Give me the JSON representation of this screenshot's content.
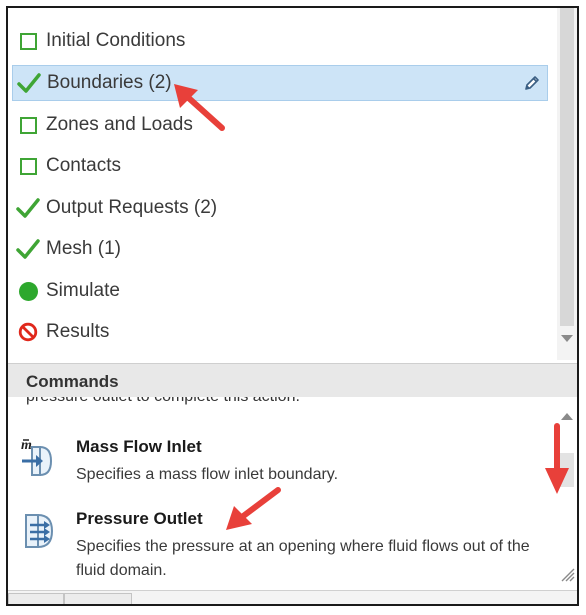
{
  "tree": {
    "items": [
      {
        "label": "Initial Conditions",
        "status": "incomplete"
      },
      {
        "label": "Boundaries (2)",
        "status": "complete",
        "selected": true
      },
      {
        "label": "Zones and Loads",
        "status": "incomplete"
      },
      {
        "label": "Contacts",
        "status": "incomplete"
      },
      {
        "label": "Output Requests (2)",
        "status": "complete"
      },
      {
        "label": "Mesh (1)",
        "status": "complete"
      },
      {
        "label": "Simulate",
        "status": "ready"
      },
      {
        "label": "Results",
        "status": "unavailable"
      }
    ]
  },
  "commands": {
    "header": "Commands",
    "truncated_text": "pressure outlet to complete this action.",
    "items": [
      {
        "title": "Mass Flow Inlet",
        "description": "Specifies a mass flow inlet boundary.",
        "icon": "mass-flow-inlet-icon"
      },
      {
        "title": "Pressure Outlet",
        "description": "Specifies the pressure at an opening where fluid flows out of the fluid domain.",
        "icon": "pressure-outlet-icon"
      }
    ]
  },
  "colors": {
    "status_green": "#3fa535",
    "selection_bg": "#cde4f7",
    "annotation_red": "#e8403a",
    "results_red": "#e0281c"
  }
}
